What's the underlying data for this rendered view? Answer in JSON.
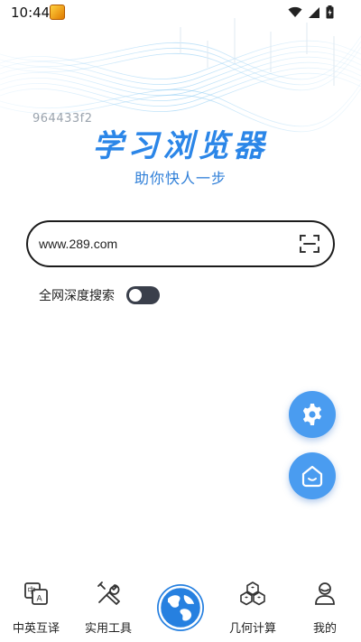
{
  "status_bar": {
    "time": "10:44"
  },
  "watermark": "964433f2",
  "app": {
    "title": "学习浏览器",
    "slogan": "助你快人一步"
  },
  "search": {
    "value": "www.289.com"
  },
  "deep_search": {
    "label": "全网深度搜索",
    "enabled": false
  },
  "bottom_nav": {
    "items": [
      {
        "label": "中英互译"
      },
      {
        "label": "实用工具"
      },
      {
        "label": "几何计算"
      },
      {
        "label": "我的"
      }
    ]
  },
  "colors": {
    "accent": "#2b86e8",
    "fab": "#4a9cf0",
    "toggle": "#3a3f4b"
  }
}
